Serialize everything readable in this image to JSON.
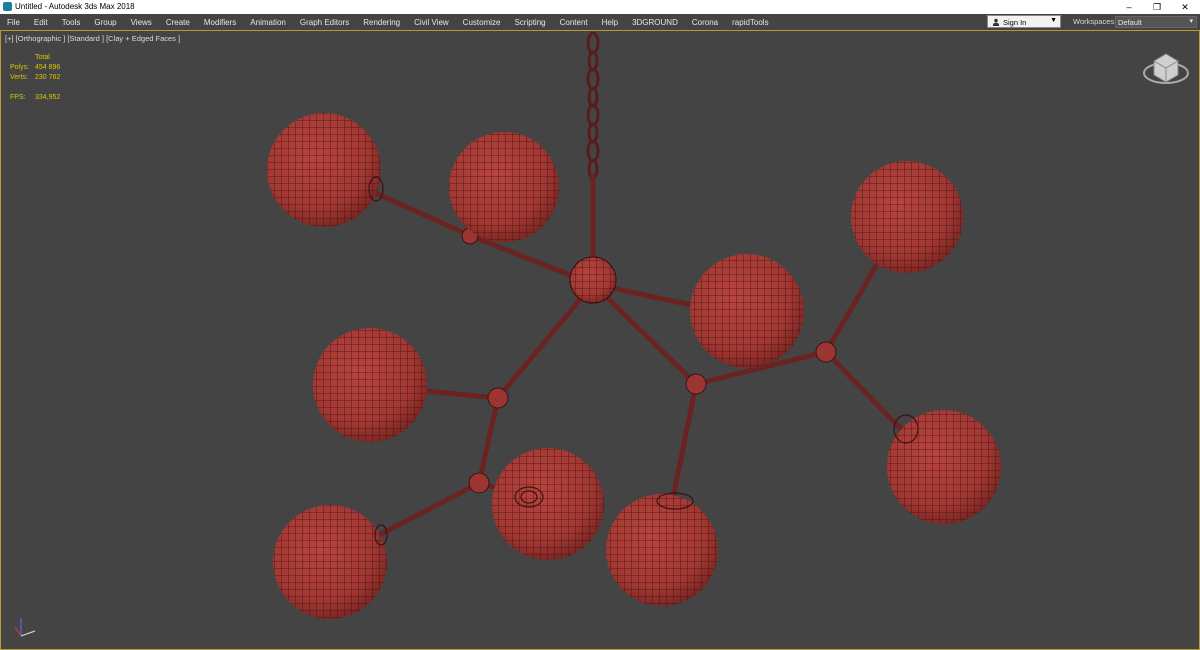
{
  "window": {
    "title": "Untitled - Autodesk 3ds Max 2018",
    "minimize": "–",
    "restore": "❐",
    "close": "✕"
  },
  "menu": [
    "File",
    "Edit",
    "Tools",
    "Group",
    "Views",
    "Create",
    "Modifiers",
    "Animation",
    "Graph Editors",
    "Rendering",
    "Civil View",
    "Customize",
    "Scripting",
    "Content",
    "Help",
    "3DGROUND",
    "Corona",
    "rapidTools"
  ],
  "signin": {
    "label": "Sign In",
    "icon": "user-icon"
  },
  "workspaces": {
    "label": "Workspaces:",
    "value": "Default"
  },
  "viewport": {
    "label": "[+] [Orthographic ] [Standard ] [Clay + Edged Faces ]",
    "stats": {
      "header": "Total",
      "polys_label": "Polys:",
      "polys": "454 896",
      "verts_label": "Verts:",
      "verts": "230 762",
      "fps_label": "FPS:",
      "fps": "334,952"
    }
  },
  "colors": {
    "viewport_bg": "#444444",
    "mesh_fill": "#a93b36",
    "mesh_line": "#3a1210",
    "stats_text": "#d9c800"
  }
}
